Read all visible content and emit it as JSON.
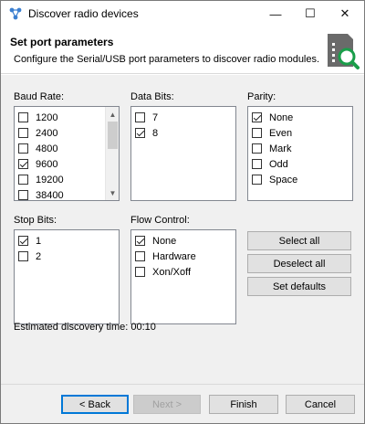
{
  "window": {
    "title": "Discover radio devices",
    "controls": {
      "minimize": "—",
      "maximize": "☐",
      "close": "✕"
    }
  },
  "header": {
    "title": "Set port parameters",
    "description": "Configure the Serial/USB port parameters to discover radio modules.",
    "graphic_icon": "radio-module-search-icon"
  },
  "baud_rate": {
    "label": "Baud Rate:",
    "options": [
      {
        "label": "1200",
        "checked": false
      },
      {
        "label": "2400",
        "checked": false
      },
      {
        "label": "4800",
        "checked": false
      },
      {
        "label": "9600",
        "checked": true
      },
      {
        "label": "19200",
        "checked": false
      },
      {
        "label": "38400",
        "checked": false
      }
    ],
    "scroll_up": "▲",
    "scroll_down": "▼"
  },
  "data_bits": {
    "label": "Data Bits:",
    "options": [
      {
        "label": "7",
        "checked": false
      },
      {
        "label": "8",
        "checked": true
      }
    ]
  },
  "parity": {
    "label": "Parity:",
    "options": [
      {
        "label": "None",
        "checked": true
      },
      {
        "label": "Even",
        "checked": false
      },
      {
        "label": "Mark",
        "checked": false
      },
      {
        "label": "Odd",
        "checked": false
      },
      {
        "label": "Space",
        "checked": false
      }
    ]
  },
  "stop_bits": {
    "label": "Stop Bits:",
    "options": [
      {
        "label": "1",
        "checked": true
      },
      {
        "label": "2",
        "checked": false
      }
    ]
  },
  "flow_control": {
    "label": "Flow Control:",
    "options": [
      {
        "label": "None",
        "checked": true
      },
      {
        "label": "Hardware",
        "checked": false
      },
      {
        "label": "Xon/Xoff",
        "checked": false
      }
    ]
  },
  "actions": {
    "select_all": "Select all",
    "deselect_all": "Deselect all",
    "set_defaults": "Set defaults"
  },
  "estimate": "Estimated discovery time: 00:10",
  "footer": {
    "back": "< Back",
    "next": "Next >",
    "finish": "Finish",
    "cancel": "Cancel"
  },
  "colors": {
    "accent": "#0078d7",
    "icon_gray": "#6a6a6a",
    "icon_green": "#1a9e4a"
  }
}
